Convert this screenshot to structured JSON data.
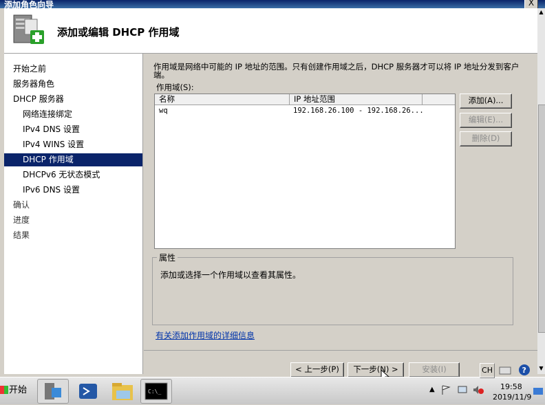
{
  "window": {
    "title": "添加角色向导",
    "close": "X"
  },
  "header": {
    "title": "添加或编辑 DHCP 作用域"
  },
  "nav": {
    "items": [
      {
        "label": "开始之前"
      },
      {
        "label": "服务器角色"
      },
      {
        "label": "DHCP 服务器"
      },
      {
        "label": "网络连接绑定"
      },
      {
        "label": "IPv4 DNS 设置"
      },
      {
        "label": "IPv4 WINS 设置"
      },
      {
        "label": "DHCP 作用域"
      },
      {
        "label": "DHCPv6 无状态模式"
      },
      {
        "label": "IPv6 DNS 设置"
      },
      {
        "label": "确认"
      },
      {
        "label": "进度"
      },
      {
        "label": "结果"
      }
    ]
  },
  "main": {
    "description": "作用域是网络中可能的 IP 地址的范围。只有创建作用域之后，DHCP 服务器才可以将 IP 地址分发到客户端。",
    "scopes_label": "作用域(S):",
    "columns": [
      "名称",
      "IP 地址范围"
    ],
    "rows": [
      {
        "name": "wq",
        "range": "192.168.26.100 - 192.168.26..."
      }
    ],
    "buttons": {
      "add": "添加(A)...",
      "edit": "编辑(E)...",
      "delete": "删除(D)"
    },
    "properties": {
      "legend": "属性",
      "text": "添加或选择一个作用域以查看其属性。"
    },
    "help_link": "有关添加作用域的详细信息"
  },
  "footer": {
    "back": "< 上一步(P)",
    "next": "下一步(N) >",
    "install": "安装(I)"
  },
  "taskbar": {
    "start": "开始",
    "lang": "CH",
    "time": "19:58",
    "date": "2019/11/9"
  },
  "colors": {
    "selection": "#0a246a",
    "titlebar": "#0a246a",
    "link": "#0033aa"
  }
}
